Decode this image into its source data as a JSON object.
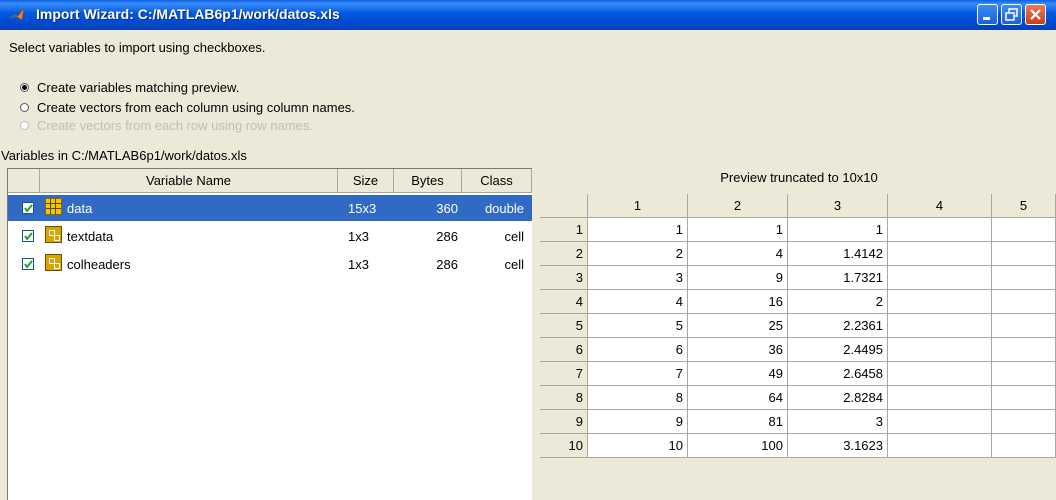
{
  "window": {
    "title": "Import Wizard: C:/MATLAB6p1/work/datos.xls",
    "title_icon": "matlab-logo-icon"
  },
  "instruction": "Select variables to import using checkboxes.",
  "options": [
    {
      "label": "Create variables matching preview.",
      "selected": true,
      "enabled": true
    },
    {
      "label": "Create vectors from each column using column names.",
      "selected": false,
      "enabled": true
    },
    {
      "label": "Create vectors from each row using row names.",
      "selected": false,
      "enabled": false
    }
  ],
  "variables_label": "Variables in C:/MATLAB6p1/work/datos.xls",
  "variables_table": {
    "headers": [
      "Variable Name",
      "Size",
      "Bytes",
      "Class"
    ],
    "rows": [
      {
        "checked": true,
        "icon": "matrix-icon",
        "name": "data",
        "size": "15x3",
        "bytes": "360",
        "class": "double",
        "selected": true
      },
      {
        "checked": true,
        "icon": "cell-array-icon",
        "name": "textdata",
        "size": "1x3",
        "bytes": "286",
        "class": "cell",
        "selected": false
      },
      {
        "checked": true,
        "icon": "cell-array-icon",
        "name": "colheaders",
        "size": "1x3",
        "bytes": "286",
        "class": "cell",
        "selected": false
      }
    ]
  },
  "preview": {
    "title": "Preview truncated to 10x10",
    "column_headers": [
      "1",
      "2",
      "3",
      "4",
      "5"
    ],
    "row_headers": [
      "1",
      "2",
      "3",
      "4",
      "5",
      "6",
      "7",
      "8",
      "9",
      "10"
    ],
    "rows": [
      [
        "1",
        "1",
        "1",
        "",
        ""
      ],
      [
        "2",
        "4",
        "1.4142",
        "",
        ""
      ],
      [
        "3",
        "9",
        "1.7321",
        "",
        ""
      ],
      [
        "4",
        "16",
        "2",
        "",
        ""
      ],
      [
        "5",
        "25",
        "2.2361",
        "",
        ""
      ],
      [
        "6",
        "36",
        "2.4495",
        "",
        ""
      ],
      [
        "7",
        "49",
        "2.6458",
        "",
        ""
      ],
      [
        "8",
        "64",
        "2.8284",
        "",
        ""
      ],
      [
        "9",
        "81",
        "3",
        "",
        ""
      ],
      [
        "10",
        "100",
        "3.1623",
        "",
        ""
      ]
    ]
  },
  "colors": {
    "title_bar": "#0058e0",
    "selection": "#316ac5",
    "dialog_bg": "#ece9d8"
  }
}
